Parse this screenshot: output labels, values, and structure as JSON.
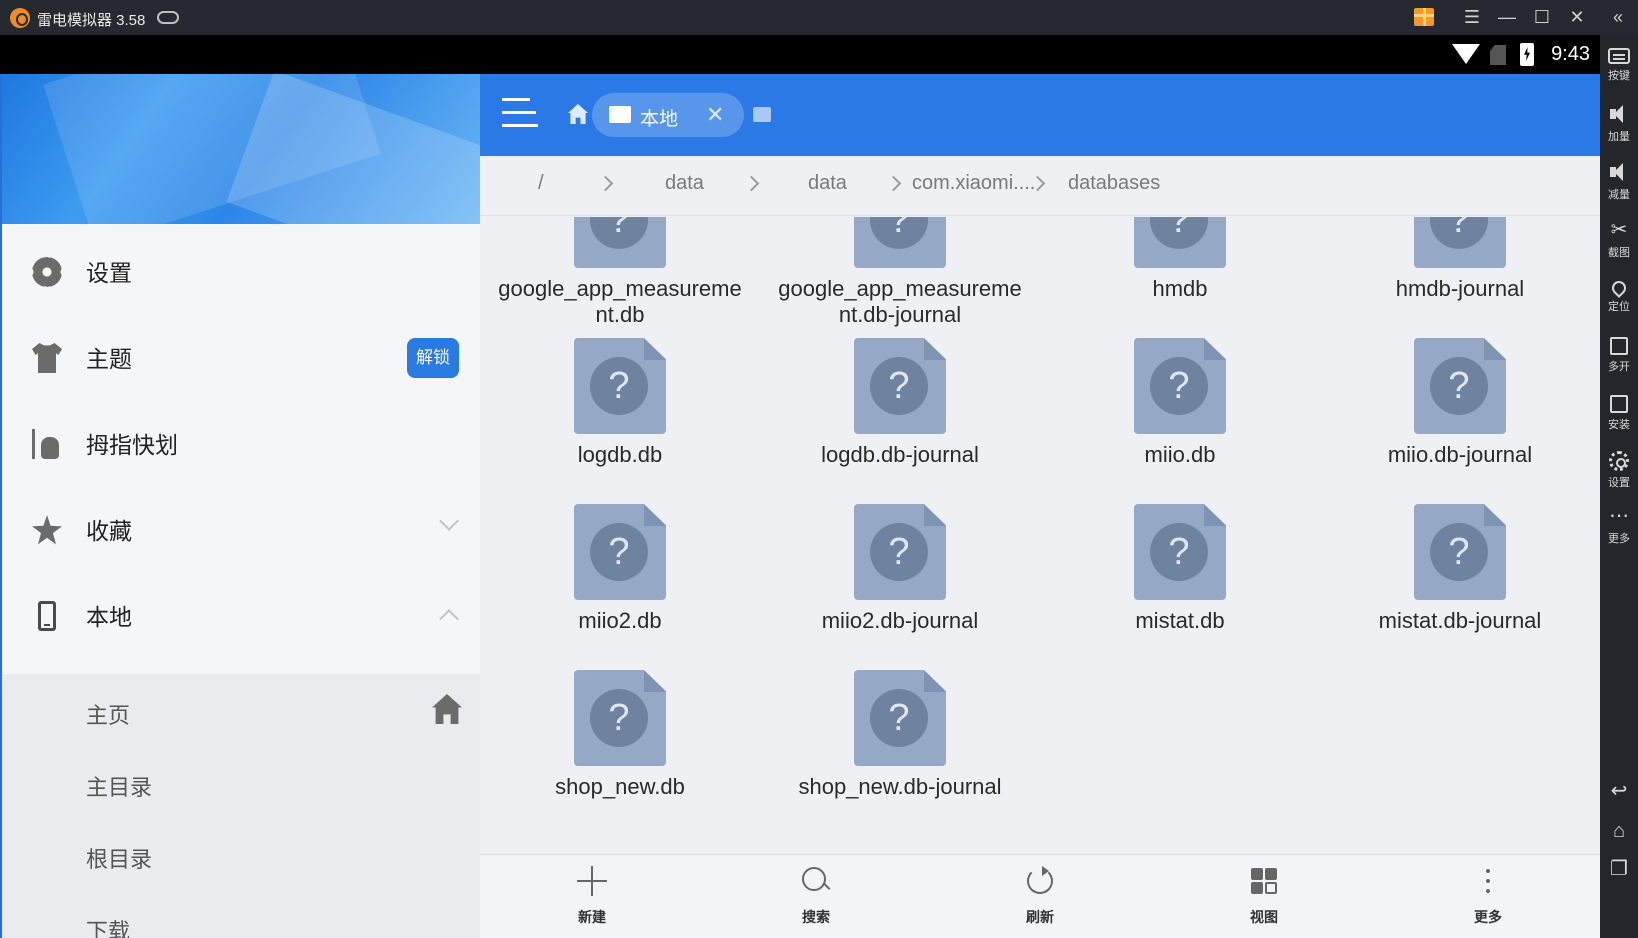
{
  "emulator": {
    "title": "雷电模拟器 3.58",
    "controls": {
      "menu": "☰",
      "minimize": "—",
      "maximize": "☐",
      "close": "✕",
      "collapse": "«"
    },
    "side_tools": [
      {
        "label": "按键",
        "icon": "keyboard-icon"
      },
      {
        "label": "加量",
        "icon": "volume-up-icon"
      },
      {
        "label": "减量",
        "icon": "volume-down-icon"
      },
      {
        "label": "截图",
        "icon": "scissors-icon"
      },
      {
        "label": "定位",
        "icon": "location-icon"
      },
      {
        "label": "多开",
        "icon": "multi-instance-icon"
      },
      {
        "label": "安装",
        "icon": "apk-install-icon"
      },
      {
        "label": "设置",
        "icon": "gear-icon"
      },
      {
        "label": "更多",
        "icon": "more-icon"
      }
    ]
  },
  "statusbar": {
    "time": "9:43"
  },
  "drawer": {
    "items": [
      {
        "label": "设置",
        "icon": "gear-icon"
      },
      {
        "label": "主题",
        "icon": "shirt-icon",
        "badge": "解锁"
      },
      {
        "label": "拇指快划",
        "icon": "swipe-hand-icon"
      },
      {
        "label": "收藏",
        "icon": "star-icon"
      },
      {
        "label": "本地",
        "icon": "phone-icon"
      }
    ],
    "sub_items": [
      "主页",
      "主目录",
      "根目录",
      "下载"
    ]
  },
  "appbar": {
    "tab_label": "本地"
  },
  "breadcrumb": [
    "/",
    "data",
    "data",
    "com.xiaomi....",
    "databases"
  ],
  "files": [
    {
      "name": "google_app_measureme\nnt.db"
    },
    {
      "name": "google_app_measureme\nnt.db-journal"
    },
    {
      "name": "hmdb"
    },
    {
      "name": "hmdb-journal"
    },
    {
      "name": "logdb.db"
    },
    {
      "name": "logdb.db-journal"
    },
    {
      "name": "miio.db"
    },
    {
      "name": "miio.db-journal"
    },
    {
      "name": "miio2.db"
    },
    {
      "name": "miio2.db-journal"
    },
    {
      "name": "mistat.db"
    },
    {
      "name": "mistat.db-journal"
    },
    {
      "name": "shop_new.db"
    },
    {
      "name": "shop_new.db-journal"
    }
  ],
  "actions": [
    "新建",
    "搜索",
    "刷新",
    "视图",
    "更多"
  ],
  "colors": {
    "accent": "#2a79e6",
    "file_icon": "#95a8c6"
  }
}
